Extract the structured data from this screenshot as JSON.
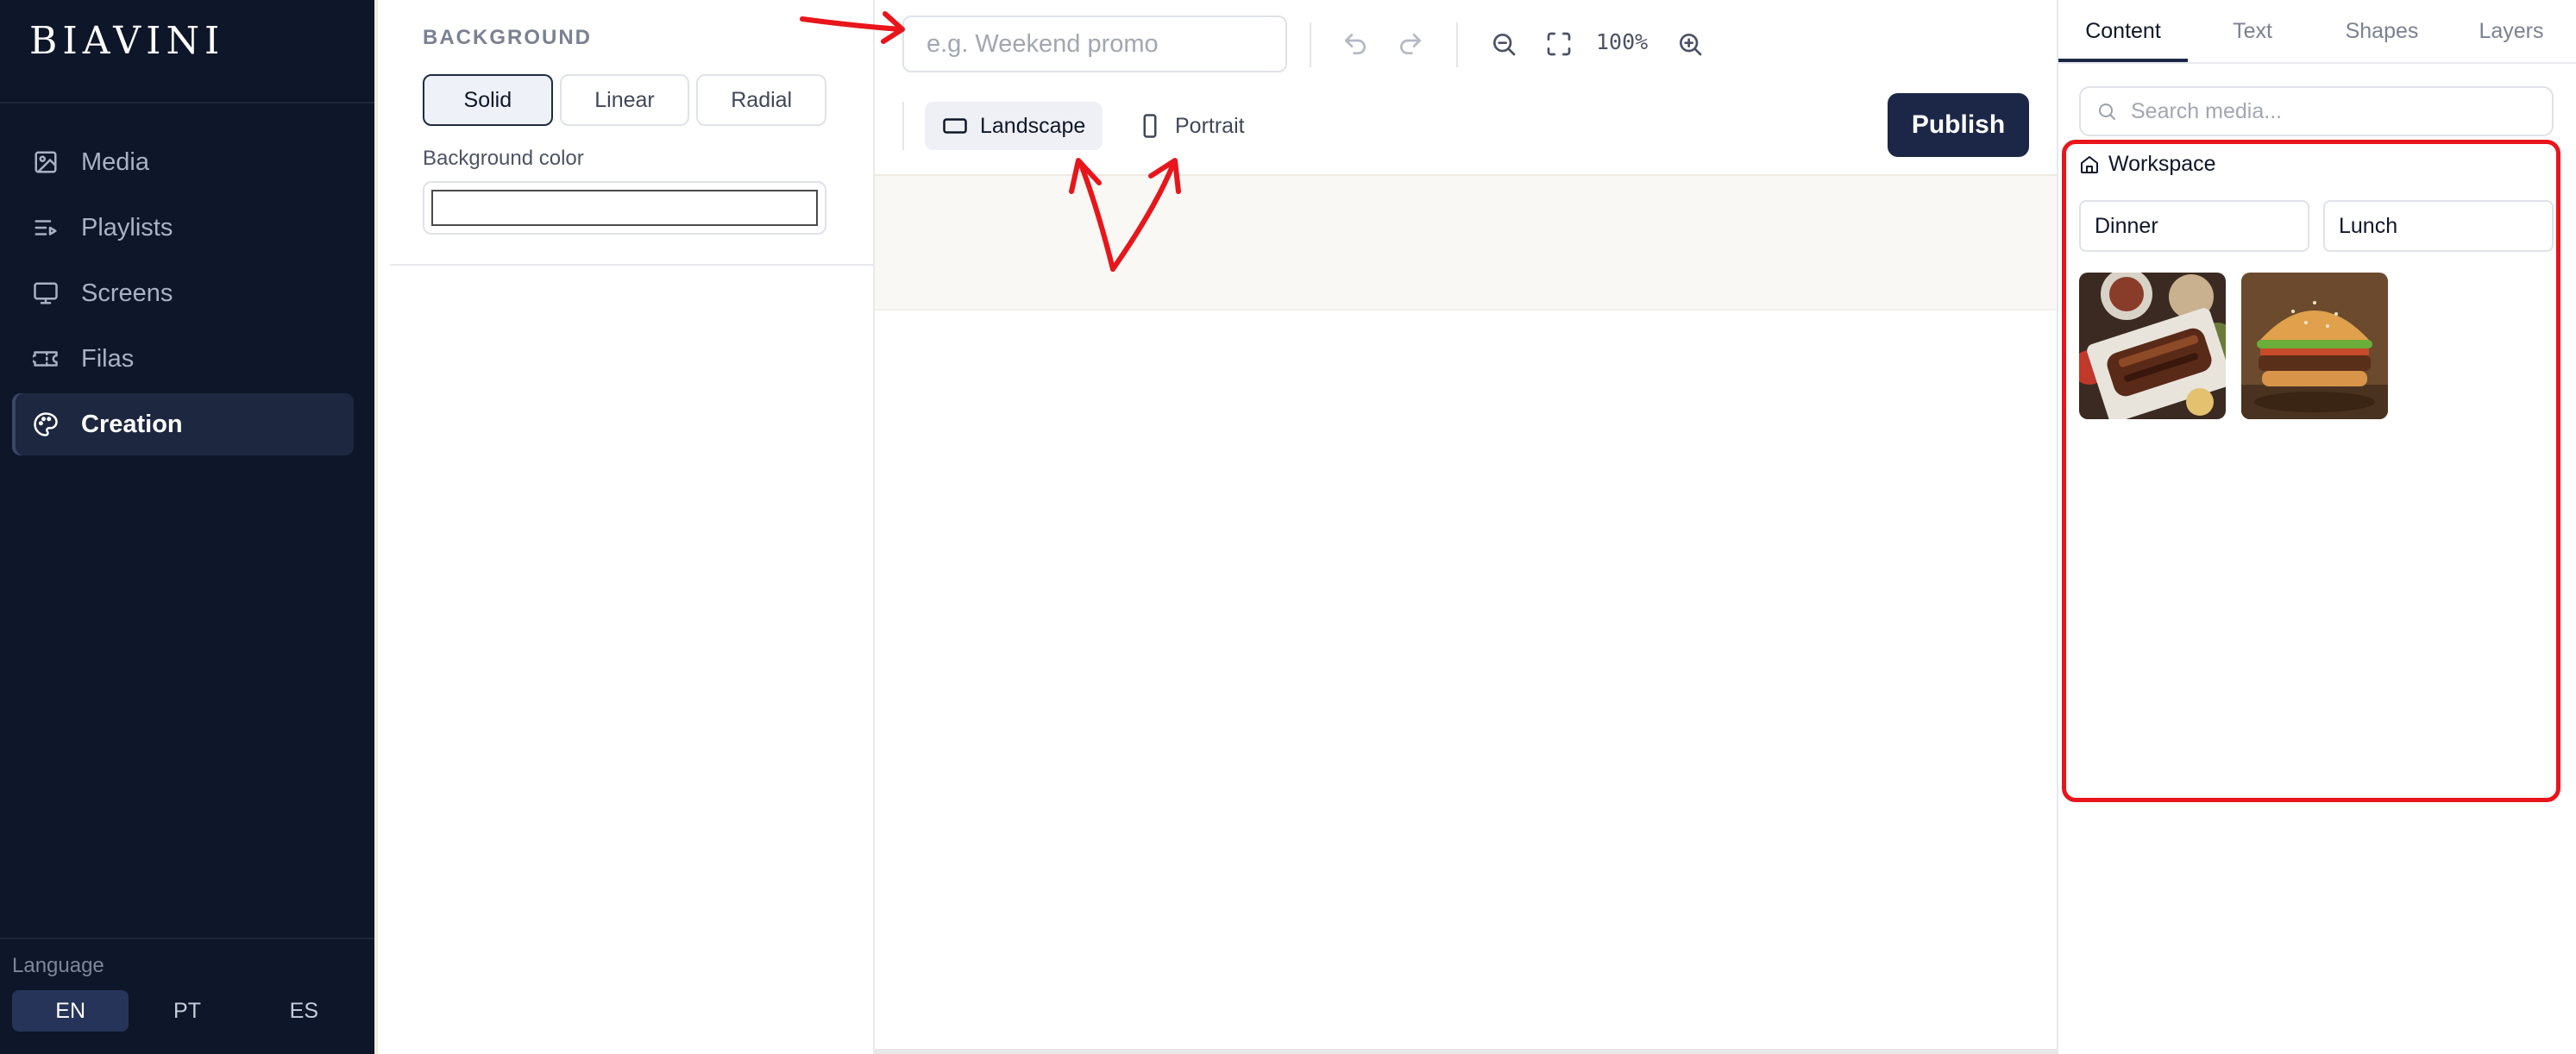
{
  "sidebar": {
    "logo": "BIAVINI",
    "items": [
      {
        "label": "Media",
        "icon": "image-icon"
      },
      {
        "label": "Playlists",
        "icon": "playlist-icon"
      },
      {
        "label": "Screens",
        "icon": "monitor-icon"
      },
      {
        "label": "Filas",
        "icon": "ticket-icon"
      },
      {
        "label": "Creation",
        "icon": "palette-icon",
        "active": true
      }
    ],
    "language": {
      "label": "Language",
      "options": [
        "EN",
        "PT",
        "ES"
      ],
      "selected": "EN"
    }
  },
  "properties": {
    "section_title": "BACKGROUND",
    "fill_types": [
      "Solid",
      "Linear",
      "Radial"
    ],
    "selected_fill": "Solid",
    "color_label": "Background color",
    "color_value": "#ffffff"
  },
  "toolbar": {
    "name_placeholder": "e.g. Weekend promo",
    "zoom": "100%",
    "orientations": [
      "Landscape",
      "Portrait"
    ],
    "selected_orientation": "Landscape",
    "publish_label": "Publish"
  },
  "right_panel": {
    "tabs": [
      "Content",
      "Text",
      "Shapes",
      "Layers"
    ],
    "active_tab": "Content",
    "search_placeholder": "Search media...",
    "workspace_label": "Workspace",
    "folders": [
      "Dinner",
      "Lunch"
    ],
    "media": [
      {
        "name": "grilled-meat-thumbnail"
      },
      {
        "name": "burger-thumbnail"
      }
    ]
  },
  "colors": {
    "sidebar_bg": "#0e1629",
    "primary": "#1c2747",
    "annotation": "#e8151b"
  }
}
